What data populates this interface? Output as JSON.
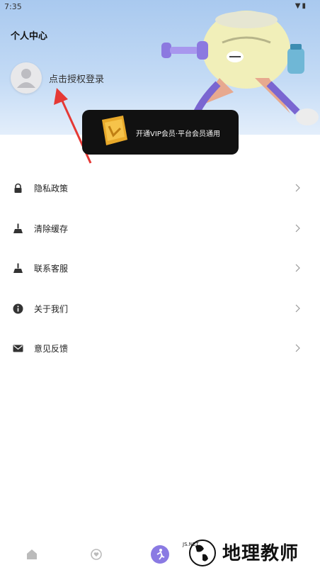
{
  "status_bar": {
    "time": "7:35",
    "icons": [
      "wifi-icon",
      "signal-icon",
      "battery-icon"
    ]
  },
  "header": {
    "title": "个人中心",
    "login_text": "点击授权登录"
  },
  "vip_banner": {
    "text": "开通VIP会员·平台会员通用"
  },
  "menu": {
    "items": [
      {
        "label": "隐私政策",
        "icon": "lock-icon"
      },
      {
        "label": "清除缓存",
        "icon": "broom-icon"
      },
      {
        "label": "联系客服",
        "icon": "broom-icon"
      },
      {
        "label": "关于我们",
        "icon": "info-icon"
      },
      {
        "label": "意见反馈",
        "icon": "mail-icon"
      }
    ]
  },
  "tabbar": {
    "tabs": [
      "home-icon",
      "heart-icon",
      "fitness-icon"
    ]
  },
  "watermark": {
    "text": "地理教师",
    "mark": "JS.NET"
  },
  "colors": {
    "header_top": "#a9c9ef",
    "banner_bg": "#111111",
    "arrow": "#e53935"
  }
}
